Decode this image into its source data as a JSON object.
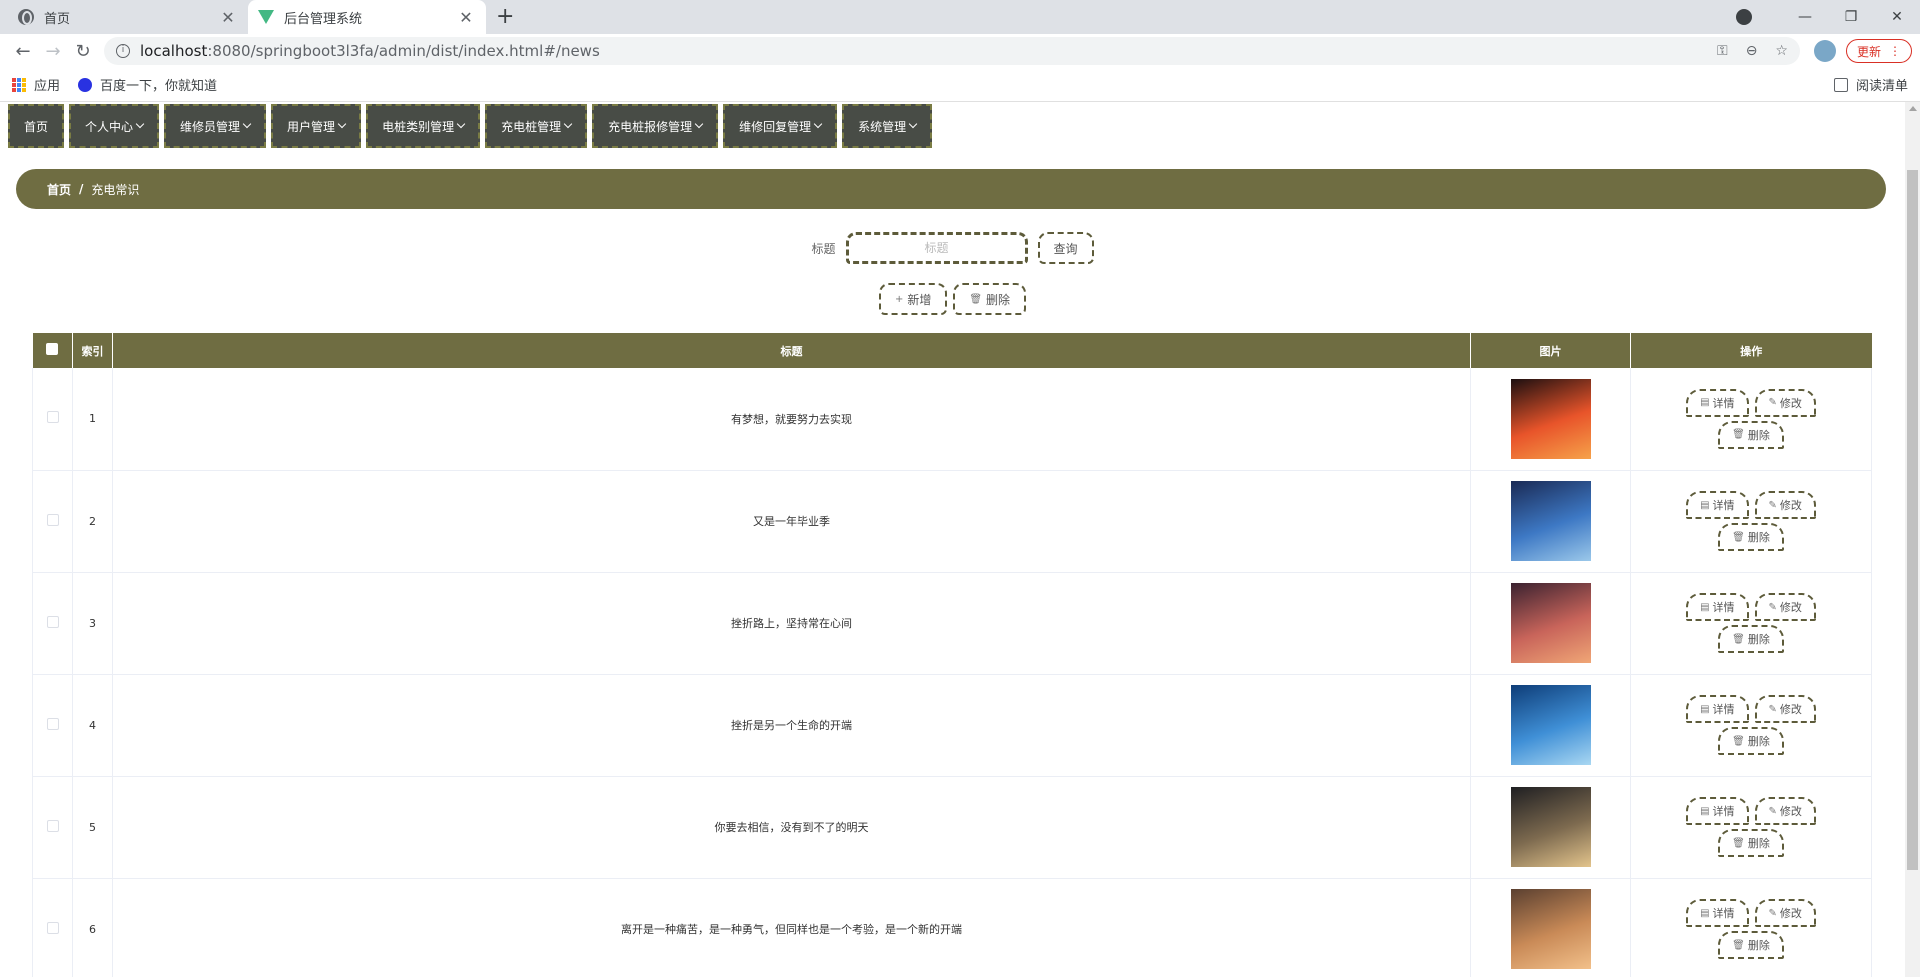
{
  "browser": {
    "tabs": [
      {
        "title": "首页",
        "icon": "globe-icon"
      },
      {
        "title": "后台管理系统",
        "icon": "vue-logo-icon"
      }
    ],
    "url_host": "localhost",
    "url_path": ":8080/springboot3l3fa/admin/dist/index.html#/news",
    "update_label": "更新",
    "bookmarks": [
      {
        "label": "应用",
        "icon": "apps-grid-icon"
      },
      {
        "label": "百度一下，你就知道",
        "icon": "baidu-paw-icon"
      }
    ],
    "reading_list": "阅读清单"
  },
  "menu": [
    {
      "label": "首页",
      "has_dropdown": false
    },
    {
      "label": "个人中心",
      "has_dropdown": true
    },
    {
      "label": "维修员管理",
      "has_dropdown": true
    },
    {
      "label": "用户管理",
      "has_dropdown": true
    },
    {
      "label": "电桩类别管理",
      "has_dropdown": true
    },
    {
      "label": "充电桩管理",
      "has_dropdown": true
    },
    {
      "label": "充电桩报修管理",
      "has_dropdown": true
    },
    {
      "label": "维修回复管理",
      "has_dropdown": true
    },
    {
      "label": "系统管理",
      "has_dropdown": true
    }
  ],
  "breadcrumb": {
    "home": "首页",
    "separator": "/",
    "current": "充电常识"
  },
  "search": {
    "label": "标题",
    "placeholder": "标题",
    "button": "查询"
  },
  "actions": {
    "add": "新增",
    "delete": "删除"
  },
  "table": {
    "columns": [
      "索引",
      "标题",
      "图片",
      "操作"
    ],
    "row_actions": {
      "detail": "详情",
      "edit": "修改",
      "delete": "删除"
    },
    "rows": [
      {
        "index": "1",
        "title": "有梦想，就要努力去实现",
        "img": [
          "#1c0f10",
          "#e8542a",
          "#f6a24a"
        ]
      },
      {
        "index": "2",
        "title": "又是一年毕业季",
        "img": [
          "#1a2a55",
          "#3d78c4",
          "#9bc8ea"
        ]
      },
      {
        "index": "3",
        "title": "挫折路上，坚持常在心间",
        "img": [
          "#3b2230",
          "#c8645a",
          "#f0a676"
        ]
      },
      {
        "index": "4",
        "title": "挫折是另一个生命的开端",
        "img": [
          "#0e3d78",
          "#3f8fd6",
          "#a9d7f2"
        ]
      },
      {
        "index": "5",
        "title": "你要去相信，没有到不了的明天",
        "img": [
          "#1f1f22",
          "#7d6a4f",
          "#e3c48c"
        ]
      },
      {
        "index": "6",
        "title": "离开是一种痛苦，是一种勇气，但同样也是一个考验，是一个新的开端",
        "img": [
          "#5b4030",
          "#c98a57",
          "#f2c08a"
        ]
      }
    ]
  },
  "colors": {
    "accent": "#6f6d42",
    "menu_bg": "#484c46",
    "dash": "#5d5b3a"
  }
}
